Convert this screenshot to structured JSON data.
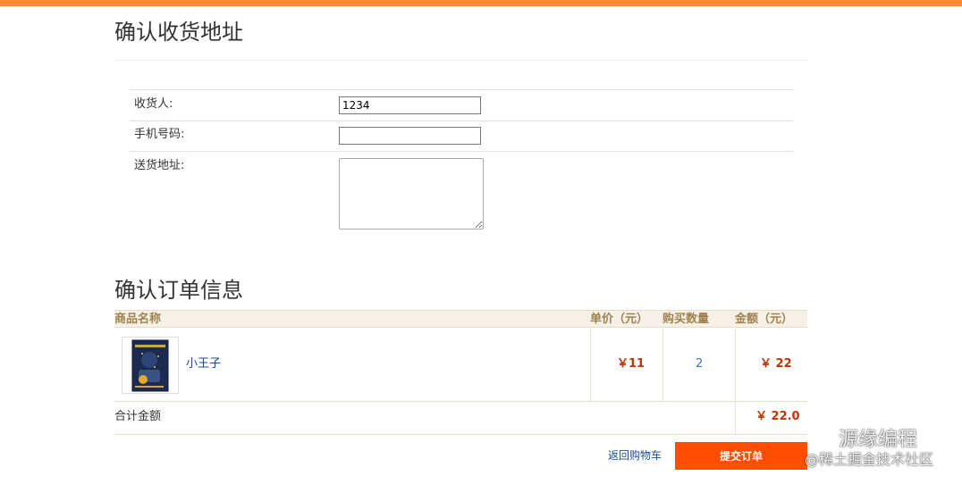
{
  "address_section": {
    "title": "确认收货地址",
    "fields": {
      "recipient": {
        "label": "收货人:",
        "value": "1234"
      },
      "phone": {
        "label": "手机号码:",
        "value": ""
      },
      "address": {
        "label": "送货地址:",
        "value": ""
      }
    }
  },
  "order_section": {
    "title": "确认订单信息",
    "columns": {
      "name": "商品名称",
      "unit_price": "单价（元）",
      "quantity": "购买数量",
      "amount": "金额（元）"
    },
    "items": [
      {
        "name": "小王子",
        "unit_price": "￥11",
        "quantity": "2",
        "amount": "￥ 22"
      }
    ],
    "total_label": "合计金额",
    "total_value": "￥ 22.0"
  },
  "actions": {
    "back_label": "返回购物车",
    "submit_label": "提交订单"
  },
  "watermark": {
    "line1": "源缘编程",
    "line2": "@稀土掘金技术社区"
  },
  "colors": {
    "top_bar": "#ff8a35",
    "submit_button": "#ff4e00",
    "price": "#c33300",
    "link": "#1a4c94",
    "table_header_bg": "#f6f1e7",
    "table_header_text": "#a0824f"
  }
}
